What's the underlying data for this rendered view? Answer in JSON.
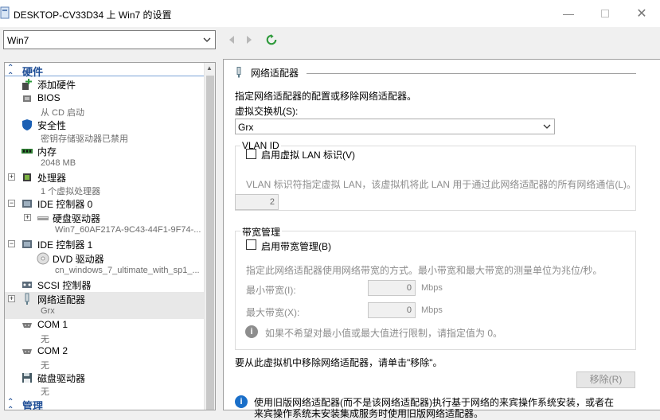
{
  "window": {
    "title": "DESKTOP-CV33D34 上 Win7 的设置"
  },
  "toolbar": {
    "vm_selected": "Win7"
  },
  "tree": {
    "hardware_header": "硬件",
    "management_header": "管理",
    "items": [
      {
        "name": "添加硬件",
        "sub": ""
      },
      {
        "name": "BIOS",
        "sub": "从 CD 启动"
      },
      {
        "name": "安全性",
        "sub": "密钥存储驱动器已禁用"
      },
      {
        "name": "内存",
        "sub": "2048 MB"
      },
      {
        "name": "处理器",
        "sub": "1 个虚拟处理器"
      },
      {
        "name": "IDE 控制器 0",
        "sub": ""
      },
      {
        "name": "硬盘驱动器",
        "sub": "Win7_60AF217A-9C43-44F1-9F74-..."
      },
      {
        "name": "IDE 控制器 1",
        "sub": ""
      },
      {
        "name": "DVD 驱动器",
        "sub": "cn_windows_7_ultimate_with_sp1_..."
      },
      {
        "name": "SCSI 控制器",
        "sub": ""
      },
      {
        "name": "网络适配器",
        "sub": "Grx"
      },
      {
        "name": "COM 1",
        "sub": "无"
      },
      {
        "name": "COM 2",
        "sub": "无"
      },
      {
        "name": "磁盘驱动器",
        "sub": "无"
      }
    ]
  },
  "panel": {
    "section_title": "网络适配器",
    "description": "指定网络适配器的配置或移除网络适配器。",
    "switch_label": "虚拟交换机(S):",
    "switch_value": "Grx",
    "vlan": {
      "group_label": "VLAN ID",
      "checkbox_label": "启用虚拟 LAN 标识(V)",
      "help": "VLAN 标识符指定虚拟 LAN，该虚拟机将此 LAN 用于通过此网络适配器的所有网络通信(L)。",
      "value": "2"
    },
    "bandwidth": {
      "group_label": "带宽管理",
      "checkbox_label": "启用带宽管理(B)",
      "help": "指定此网络适配器使用网络带宽的方式。最小带宽和最大带宽的测量单位为兆位/秒。",
      "min_label": "最小带宽(I):",
      "min_value": "0",
      "max_label": "最大带宽(X):",
      "max_value": "0",
      "unit": "Mbps",
      "info": "如果不希望对最小值或最大值进行限制，请指定值为 0。"
    },
    "remove_text": "要从此虚拟机中移除网络适配器，请单击\"移除\"。",
    "remove_button": "移除(R)",
    "legacy_info_line1": "使用旧版网络适配器(而不是该网络适配器)执行基于网络的来宾操作系统安装，或者在",
    "legacy_info_line2": "来宾操作系统未安装集成服务时使用旧版网络适配器。"
  }
}
